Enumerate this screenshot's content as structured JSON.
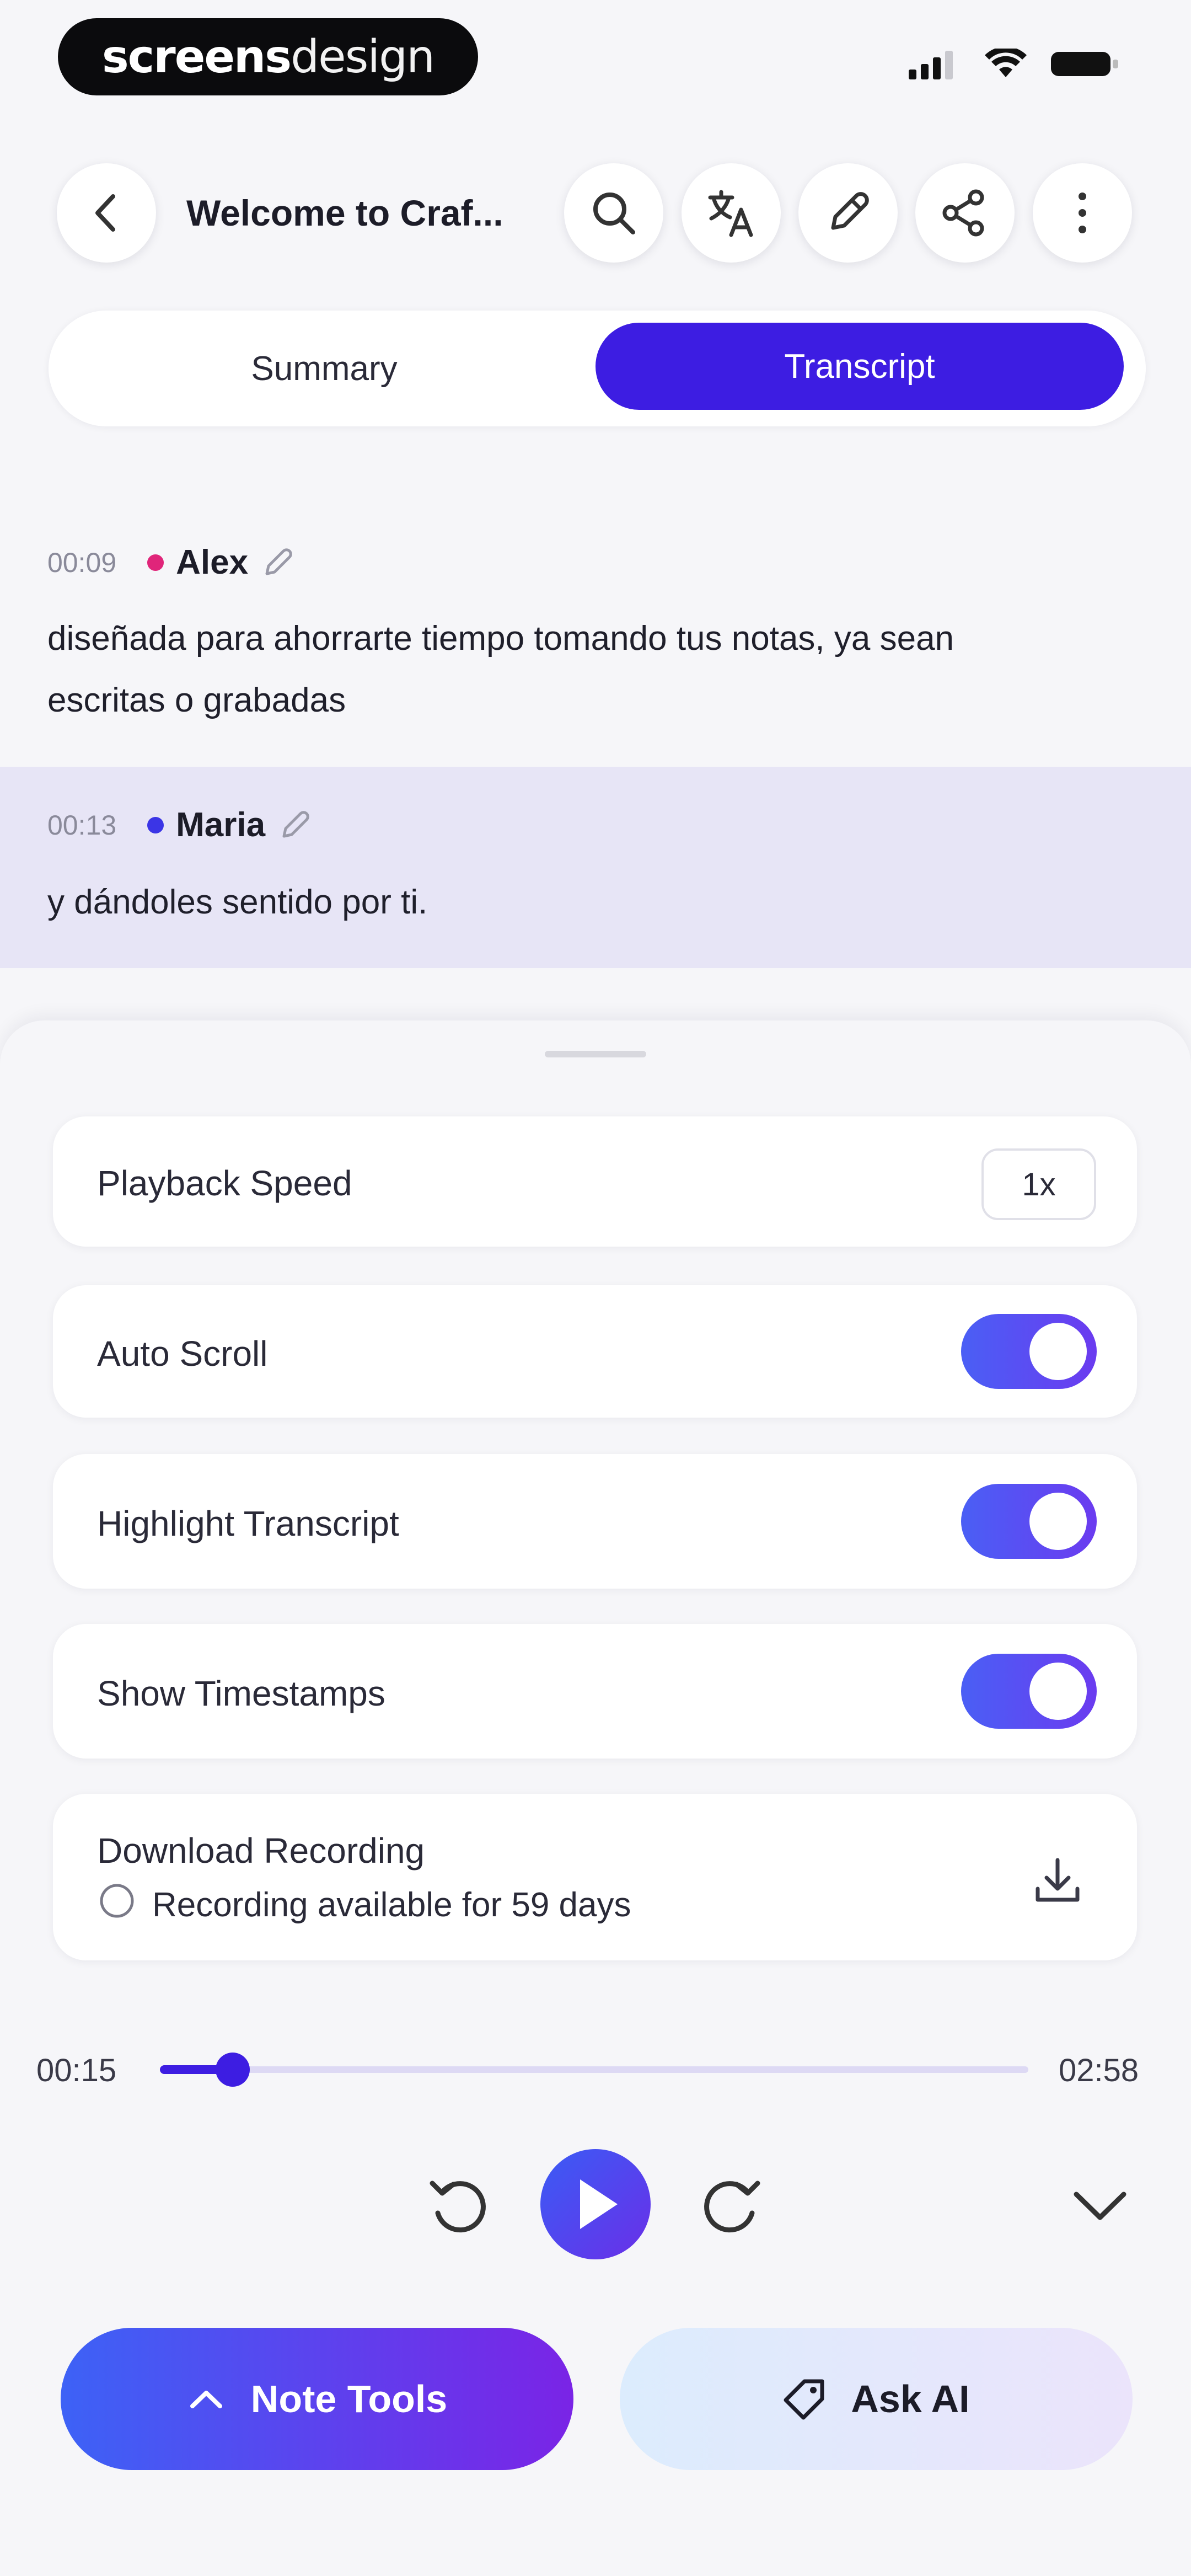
{
  "status_bar": {
    "brand_bold": "screens",
    "brand_light": "design"
  },
  "header": {
    "title": "Welcome to Craf...",
    "icons": [
      "back-icon",
      "search-icon",
      "translate-icon",
      "edit-icon",
      "share-icon",
      "more-icon"
    ]
  },
  "tabs": {
    "summary": "Summary",
    "transcript": "Transcript",
    "active": "Transcript"
  },
  "transcript": [
    {
      "time": "00:09",
      "speaker": "Alex",
      "color": "#e0257a",
      "text_line1": " diseñada para ahorrarte tiempo tomando tus notas, ya sean",
      "text_line2": "escritas o grabadas"
    },
    {
      "time": "00:13",
      "speaker": "Maria",
      "color": "#3b35e6",
      "text": " y dándoles sentido por ti."
    }
  ],
  "settings": {
    "playback_speed_label": "Playback Speed",
    "playback_speed_value": "1x",
    "auto_scroll_label": "Auto Scroll",
    "auto_scroll_on": true,
    "highlight_label": "Highlight Transcript",
    "highlight_on": true,
    "timestamps_label": "Show Timestamps",
    "timestamps_on": true,
    "download_label": "Download Recording",
    "download_sub": "Recording available for 59 days"
  },
  "player": {
    "current": "00:15",
    "total": "02:58",
    "progress": 0.084
  },
  "bottom": {
    "note_tools": "Note Tools",
    "ask_ai": "Ask AI"
  },
  "colors": {
    "accent": "#3d1de2",
    "bg": "#f6f6f9"
  }
}
